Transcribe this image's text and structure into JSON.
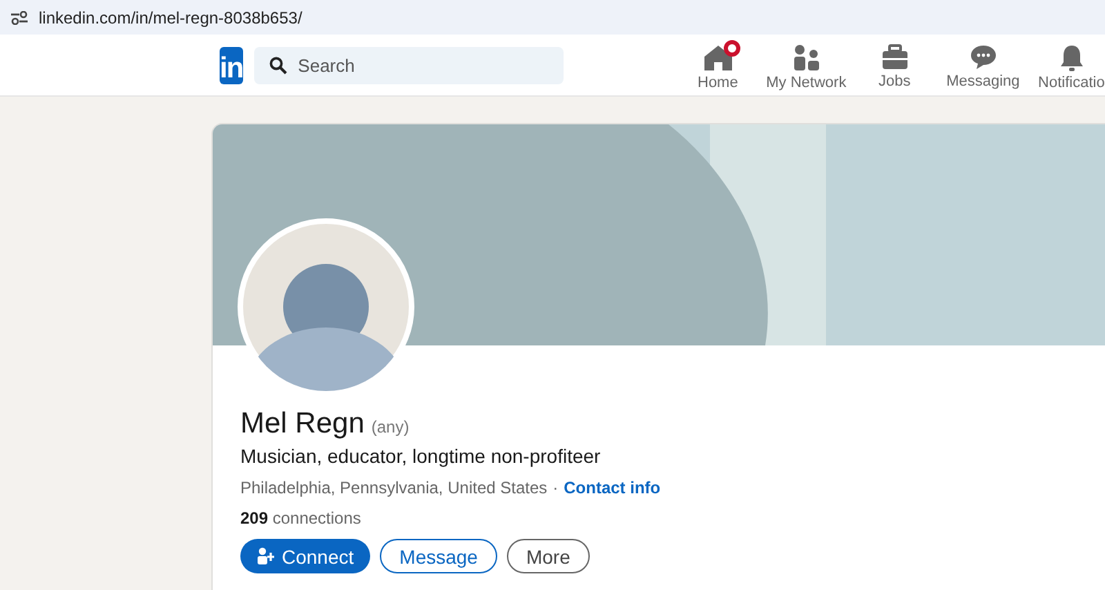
{
  "address_bar": {
    "url": "linkedin.com/in/mel-regn-8038b653/"
  },
  "nav": {
    "logo": "in",
    "search": {
      "placeholder": "Search"
    },
    "items": [
      {
        "kind": "home",
        "label": "Home",
        "notification": true
      },
      {
        "kind": "network",
        "label": "My Network",
        "notification": false
      },
      {
        "kind": "jobs",
        "label": "Jobs",
        "notification": false
      },
      {
        "kind": "messaging",
        "label": "Messaging",
        "notification": false
      },
      {
        "kind": "notifications",
        "label": "Notificatio",
        "notification": false
      }
    ]
  },
  "profile": {
    "name": "Mel Regn",
    "pronouns": "(any)",
    "headline": "Musician, educator, longtime non-profiteer",
    "location": "Philadelphia, Pennsylvania, United States",
    "separator": "·",
    "contact_link": "Contact info",
    "connections": "**209** connections",
    "buttons": [
      {
        "kind": "primary",
        "label": "Connect"
      },
      {
        "kind": "outline",
        "label": "Message"
      },
      {
        "kind": "neutral",
        "label": "More"
      }
    ]
  }
}
